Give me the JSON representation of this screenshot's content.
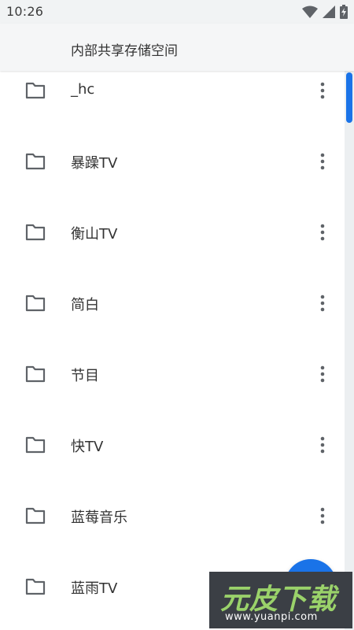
{
  "status_bar": {
    "time": "10:26",
    "icons": [
      "wifi-icon",
      "signal-icon",
      "battery-charging-icon"
    ]
  },
  "header": {
    "title": "内部共享存储空间"
  },
  "folders": [
    {
      "name": "_hc",
      "icon": "folder-icon"
    },
    {
      "name": "暴躁TV",
      "icon": "folder-icon"
    },
    {
      "name": "衡山TV",
      "icon": "folder-icon"
    },
    {
      "name": "简白",
      "icon": "folder-icon"
    },
    {
      "name": "节目",
      "icon": "folder-icon"
    },
    {
      "name": "快TV",
      "icon": "folder-icon"
    },
    {
      "name": "蓝莓音乐",
      "icon": "folder-icon"
    },
    {
      "name": "蓝雨TV",
      "icon": "folder-icon"
    }
  ],
  "fab": {
    "icon": "fab-button",
    "color": "#1a73e8"
  },
  "watermark": {
    "title": "元皮下载",
    "url": "www.yuanpi.com"
  },
  "colors": {
    "accent": "#1a73e8",
    "text": "#333333",
    "icon": "#5f6368"
  }
}
